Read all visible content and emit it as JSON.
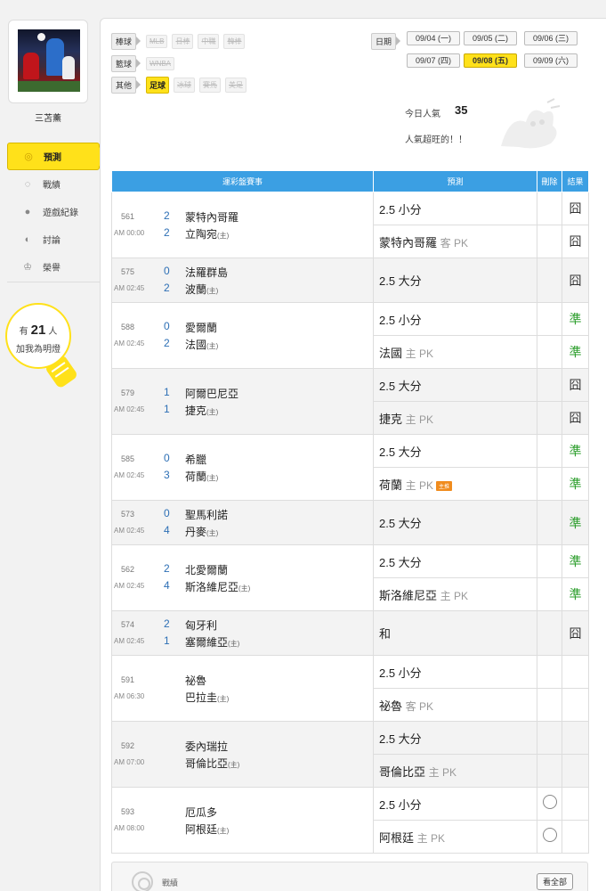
{
  "user": {
    "name": "三苫薰"
  },
  "nav": [
    {
      "label": "預測",
      "icon": "target-icon",
      "glyph": "◎",
      "active": true
    },
    {
      "label": "戰績",
      "icon": "chat-icon",
      "glyph": "◌",
      "active": false
    },
    {
      "label": "遊戲紀錄",
      "icon": "record-icon",
      "glyph": "●",
      "active": false
    },
    {
      "label": "討論",
      "icon": "discussion-icon",
      "glyph": "◐",
      "active": false
    },
    {
      "label": "榮譽",
      "icon": "trophy-icon",
      "glyph": "♔",
      "active": false
    }
  ],
  "fans": {
    "prefix": "有",
    "count": "21",
    "suffix": "人",
    "line2": "加我為明燈"
  },
  "filters": {
    "baseball": {
      "label": "棒球",
      "options": [
        "MLB",
        "日棒",
        "中職",
        "韓棒"
      ]
    },
    "basketball": {
      "label": "籃球",
      "options": [
        "WNBA"
      ]
    },
    "other": {
      "label": "其他",
      "options": [
        "足球",
        "冰球",
        "賽馬",
        "美足"
      ],
      "active": "足球"
    }
  },
  "dates": {
    "label": "日期",
    "items": [
      "09/04 (一)",
      "09/05 (二)",
      "09/06 (三)",
      "09/07 (四)",
      "09/08 (五)",
      "09/09 (六)"
    ],
    "active": "09/08 (五)"
  },
  "popularity": {
    "label": "今日人氣",
    "value": "35",
    "note": "人氣超旺的！！"
  },
  "table": {
    "headers": [
      "運彩盤賽事",
      "預測",
      "刪除",
      "結果"
    ],
    "games": [
      {
        "no": "561",
        "time": "AM 00:00",
        "s1": "2",
        "t1": "蒙特內哥羅",
        "s2": "2",
        "t2": "立陶宛",
        "home": "(主)",
        "preds": [
          {
            "main": "2.5 小分",
            "sub": "",
            "badge": "",
            "result": "囧",
            "hit": false,
            "circle": false
          },
          {
            "main": "蒙特內哥羅",
            "sub": "客 PK",
            "badge": "",
            "result": "囧",
            "hit": false,
            "circle": false
          }
        ]
      },
      {
        "no": "575",
        "time": "AM 02:45",
        "s1": "0",
        "t1": "法羅群島",
        "s2": "2",
        "t2": "波蘭",
        "home": "(主)",
        "preds": [
          {
            "main": "2.5 大分",
            "sub": "",
            "badge": "",
            "result": "囧",
            "hit": false,
            "circle": false
          }
        ]
      },
      {
        "no": "588",
        "time": "AM 02:45",
        "s1": "0",
        "t1": "愛爾蘭",
        "s2": "2",
        "t2": "法國",
        "home": "(主)",
        "preds": [
          {
            "main": "2.5 小分",
            "sub": "",
            "badge": "",
            "result": "準",
            "hit": true,
            "circle": false
          },
          {
            "main": "法國",
            "sub": "主 PK",
            "badge": "",
            "result": "準",
            "hit": true,
            "circle": false
          }
        ]
      },
      {
        "no": "579",
        "time": "AM 02:45",
        "s1": "1",
        "t1": "阿爾巴尼亞",
        "s2": "1",
        "t2": "捷克",
        "home": "(主)",
        "preds": [
          {
            "main": "2.5 大分",
            "sub": "",
            "badge": "",
            "result": "囧",
            "hit": false,
            "circle": false
          },
          {
            "main": "捷克",
            "sub": "主 PK",
            "badge": "",
            "result": "囧",
            "hit": false,
            "circle": false
          }
        ]
      },
      {
        "no": "585",
        "time": "AM 02:45",
        "s1": "0",
        "t1": "希臘",
        "s2": "3",
        "t2": "荷蘭",
        "home": "(主)",
        "preds": [
          {
            "main": "2.5 大分",
            "sub": "",
            "badge": "",
            "result": "準",
            "hit": true,
            "circle": false
          },
          {
            "main": "荷蘭",
            "sub": "主 PK",
            "badge": "主推",
            "result": "準",
            "hit": true,
            "circle": false
          }
        ]
      },
      {
        "no": "573",
        "time": "AM 02:45",
        "s1": "0",
        "t1": "聖馬利諾",
        "s2": "4",
        "t2": "丹麥",
        "home": "(主)",
        "preds": [
          {
            "main": "2.5 大分",
            "sub": "",
            "badge": "",
            "result": "準",
            "hit": true,
            "circle": false
          }
        ]
      },
      {
        "no": "562",
        "time": "AM 02:45",
        "s1": "2",
        "t1": "北愛爾蘭",
        "s2": "4",
        "t2": "斯洛維尼亞",
        "home": "(主)",
        "preds": [
          {
            "main": "2.5 大分",
            "sub": "",
            "badge": "",
            "result": "準",
            "hit": true,
            "circle": false
          },
          {
            "main": "斯洛維尼亞",
            "sub": "主 PK",
            "badge": "",
            "result": "準",
            "hit": true,
            "circle": false
          }
        ]
      },
      {
        "no": "574",
        "time": "AM 02:45",
        "s1": "2",
        "t1": "匈牙利",
        "s2": "1",
        "t2": "塞爾維亞",
        "home": "(主)",
        "preds": [
          {
            "main": "和",
            "sub": "",
            "badge": "",
            "result": "囧",
            "hit": false,
            "circle": false
          }
        ]
      },
      {
        "no": "591",
        "time": "AM 06:30",
        "s1": "",
        "t1": "祕魯",
        "s2": "",
        "t2": "巴拉圭",
        "home": "(主)",
        "preds": [
          {
            "main": "2.5 小分",
            "sub": "",
            "badge": "",
            "result": "",
            "hit": false,
            "circle": false
          },
          {
            "main": "祕魯",
            "sub": "客 PK",
            "badge": "",
            "result": "",
            "hit": false,
            "circle": false
          }
        ]
      },
      {
        "no": "592",
        "time": "AM 07:00",
        "s1": "",
        "t1": "委內瑞拉",
        "s2": "",
        "t2": "哥倫比亞",
        "home": "(主)",
        "preds": [
          {
            "main": "2.5 大分",
            "sub": "",
            "badge": "",
            "result": "",
            "hit": false,
            "circle": false
          },
          {
            "main": "哥倫比亞",
            "sub": "主 PK",
            "badge": "",
            "result": "",
            "hit": false,
            "circle": false
          }
        ]
      },
      {
        "no": "593",
        "time": "AM 08:00",
        "s1": "",
        "t1": "厄瓜多",
        "s2": "",
        "t2": "阿根廷",
        "home": "(主)",
        "preds": [
          {
            "main": "2.5 小分",
            "sub": "",
            "badge": "",
            "result": "",
            "hit": false,
            "circle": true
          },
          {
            "main": "阿根廷",
            "sub": "主 PK",
            "badge": "",
            "result": "",
            "hit": false,
            "circle": true
          }
        ]
      }
    ]
  },
  "record": {
    "label": "戰績",
    "view_all": "看全部"
  },
  "colors": {
    "accent_yellow": "#ffe11a",
    "header_blue": "#3b9fe3",
    "hit_green": "#2a9d2a",
    "score_blue": "#2d6fb5"
  }
}
